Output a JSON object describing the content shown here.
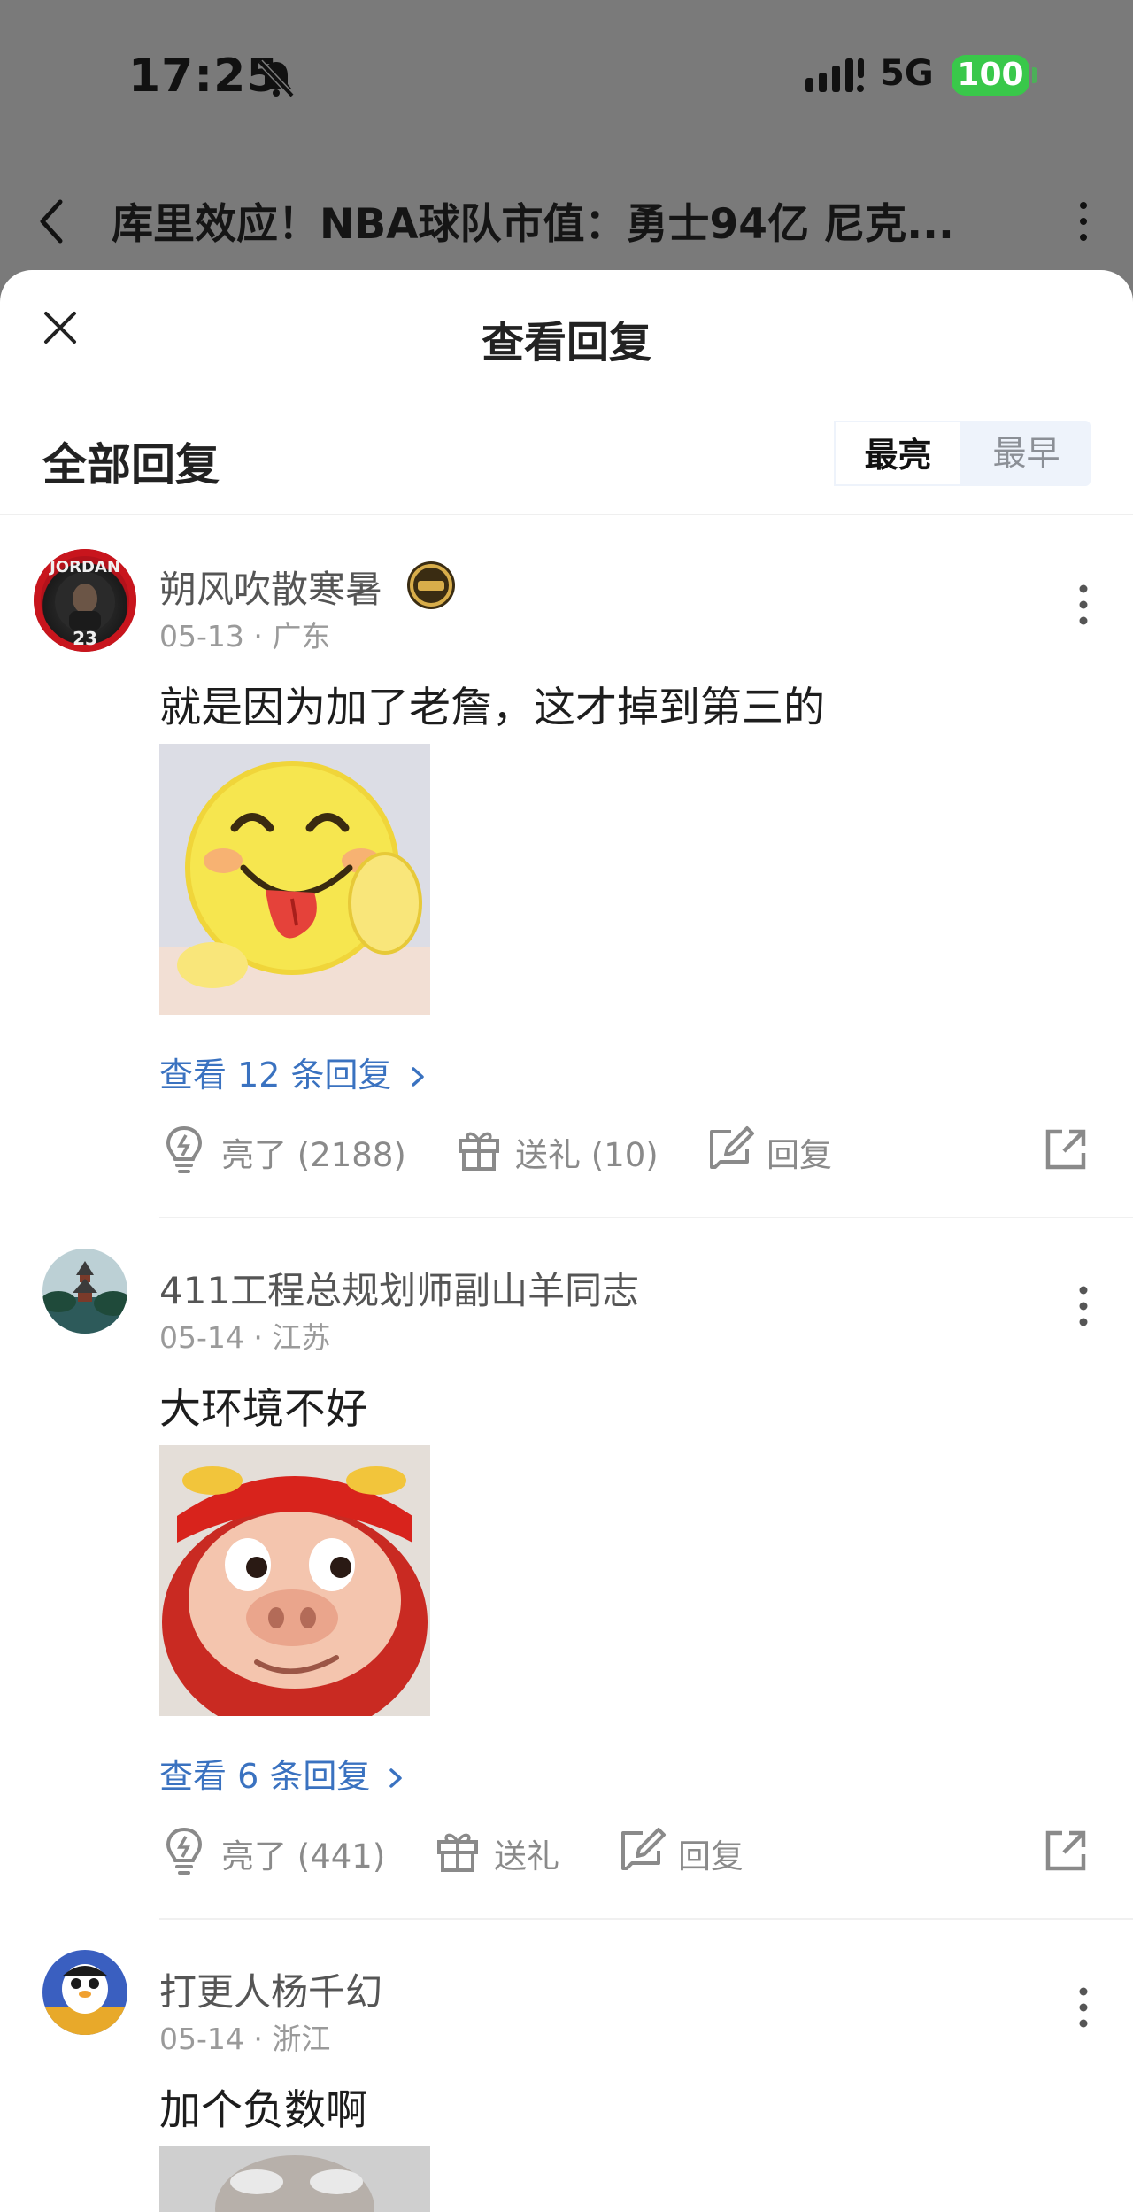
{
  "status_bar": {
    "time": "17:25",
    "network": "5G",
    "battery": "100"
  },
  "header": {
    "title": "库里效应！NBA球队市值：勇士94亿 尼克..."
  },
  "sheet": {
    "title": "查看回复",
    "all_replies": "全部回复",
    "sort": {
      "active": "最亮",
      "inactive": "最早"
    }
  },
  "comments": [
    {
      "user": "朔风吹散寒暑",
      "meta": "05-13 · 广东",
      "text": "就是因为加了老詹，这才掉到第三的",
      "avatar_text": "JORDAN",
      "avatar_number": "23",
      "view_replies": "查看 12 条回复",
      "like": "亮了 (2188)",
      "gift": "送礼 (10)",
      "reply": "回复"
    },
    {
      "user": "411工程总规划师副山羊同志",
      "meta": "05-14 · 江苏",
      "text": "大环境不好",
      "view_replies": "查看 6 条回复",
      "like": "亮了 (441)",
      "gift": "送礼",
      "reply": "回复"
    },
    {
      "user": "打更人杨千幻",
      "meta": "05-14 · 浙江",
      "text": "加个负数啊"
    }
  ],
  "colors": {
    "link": "#3a72c0",
    "battery": "#39c84a"
  }
}
